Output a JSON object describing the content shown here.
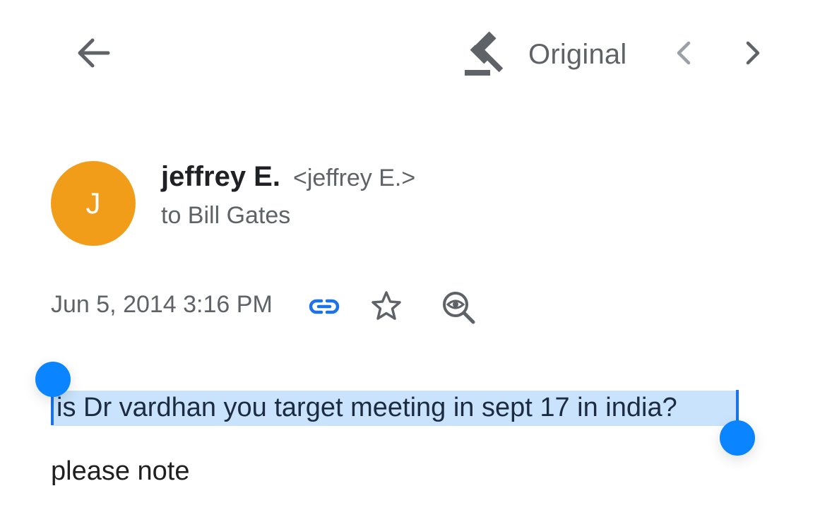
{
  "header": {
    "back_icon": "arrow-back-icon",
    "original_label": "Original",
    "original_icon": "gavel-icon",
    "prev_icon": "chevron-left-icon",
    "next_icon": "chevron-right-icon"
  },
  "sender": {
    "avatar_initial": "J",
    "avatar_color": "#f29d1a",
    "name": "jeffrey E.",
    "email": "<jeffrey E.>",
    "recipient": "to Bill Gates"
  },
  "meta": {
    "date": "Jun 5, 2014 3:16 PM",
    "link_icon": "link-icon",
    "star_icon": "star-icon",
    "lens_icon": "magnifier-eye-icon",
    "link_color": "#1a73e8"
  },
  "body": {
    "line1": "is Dr vardhan you target meeting in sept 17 in india?",
    "line2": "please note",
    "selection_color": "#c8e3fb",
    "handle_color": "#0a84ff"
  }
}
